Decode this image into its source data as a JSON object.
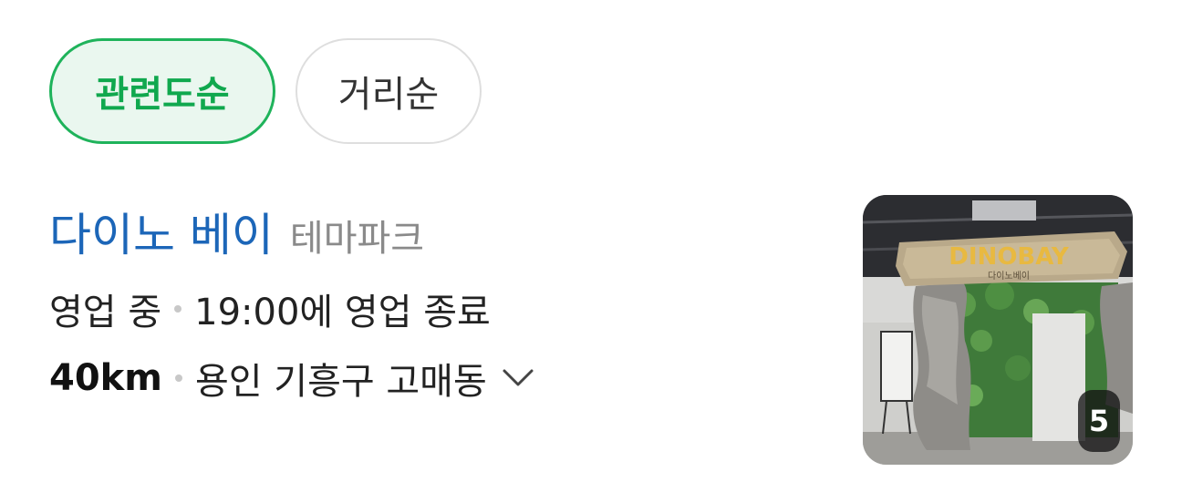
{
  "sort_chips": [
    {
      "label": "관련도순",
      "selected": true
    },
    {
      "label": "거리순",
      "selected": false
    }
  ],
  "result": {
    "name": "다이노 베이",
    "category": "테마파크",
    "status": "영업 중",
    "hours_note": "19:00에 영업 종료",
    "distance": "40km",
    "address": "용인 기흥구 고매동",
    "photo": {
      "count": "5",
      "sign_text": "DINOBAY",
      "sign_subtext": "다이노베이"
    }
  },
  "colors": {
    "accent_green": "#10a84e",
    "link_blue": "#1c66b8"
  },
  "icons": {
    "expand": "chevron-down-icon"
  }
}
